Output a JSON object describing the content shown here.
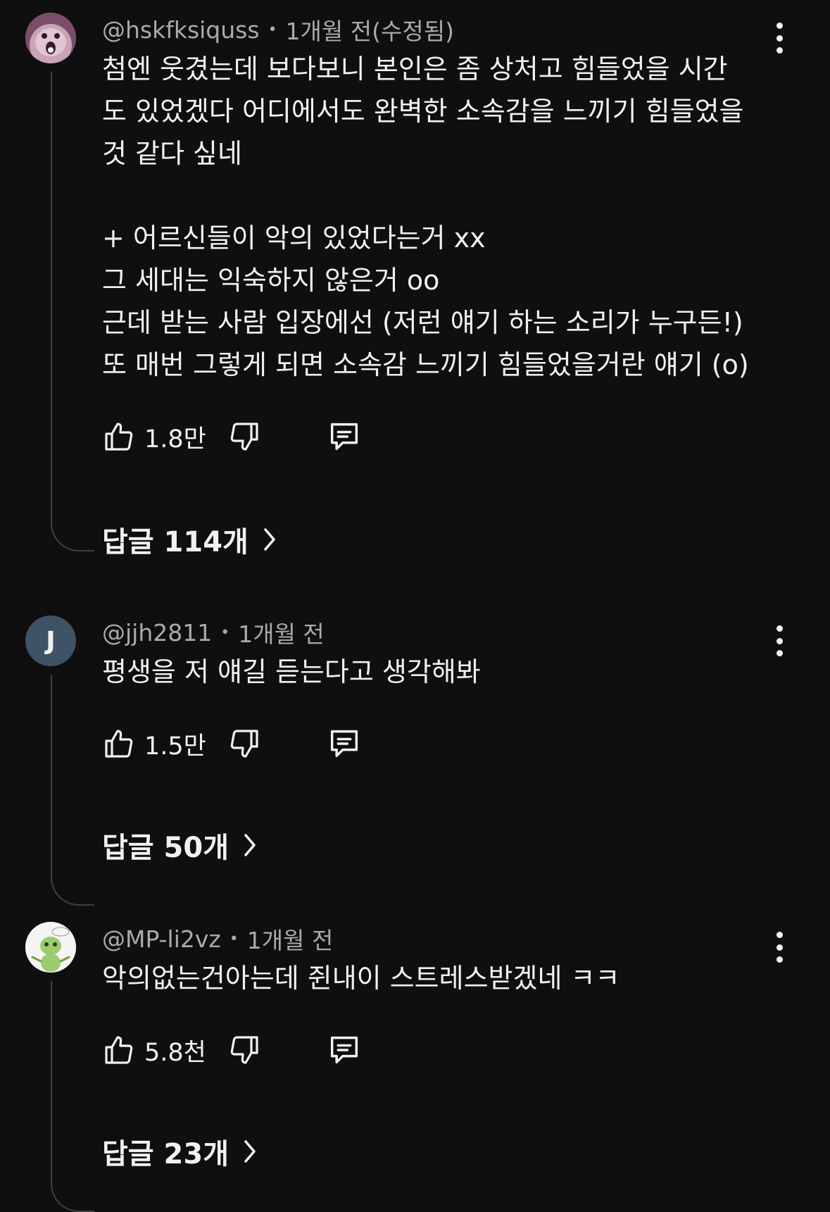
{
  "comments": [
    {
      "username": "@hskfksiquss",
      "separator": "•",
      "time": "1개월 전(수정됨)",
      "text": "첨엔 웃겼는데 보다보니 본인은 좀 상처고 힘들었을 시간\n도 있었겠다 어디에서도 완벽한 소속감을 느끼기 힘들었을\n것 같다 싶네\n\n+ 어르신들이 악의 있었다는거 xx\n그 세대는 익숙하지 않은거 oo\n근데 받는 사람 입장에선 (저런 얘기 하는 소리가 누구든!)\n또 매번 그렇게 되면 소속감 느끼기 힘들었을거란 얘기 (o)",
      "likes": "1.8만",
      "replies": "답글 114개",
      "avatar_icon": "pink-creature-avatar"
    },
    {
      "username": "@jjh2811",
      "separator": "•",
      "time": "1개월 전",
      "text": "평생을 저 얘길 듣는다고 생각해봐",
      "likes": "1.5만",
      "replies": "답글 50개",
      "avatar_letter": "J",
      "avatar_color": "#3e5366"
    },
    {
      "username": "@MP-li2vz",
      "separator": "•",
      "time": "1개월 전",
      "text": "악의없는건아는데 쥔내이 스트레스받겠네 ㅋㅋ",
      "likes": "5.8천",
      "replies": "답글 23개",
      "avatar_icon": "green-character-avatar"
    }
  ],
  "colors": {
    "background": "#0f0f0f",
    "primary_text": "#f1f1f1",
    "secondary_text": "#aaaaaa",
    "thread_line": "#3f3f3f"
  },
  "icons": [
    "thumb-up-icon",
    "thumb-down-icon",
    "comment-reply-icon",
    "more-vert-icon",
    "chevron-right-icon"
  ]
}
